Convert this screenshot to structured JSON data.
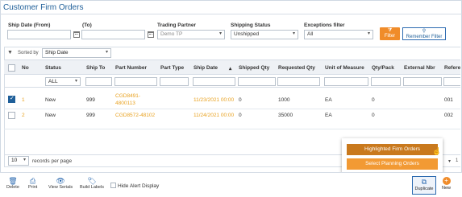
{
  "page": {
    "title": "Customer Firm Orders"
  },
  "filters": {
    "ship_date_from_label": "Ship Date (From)",
    "ship_date_to_label": "(To)",
    "ship_date_from_value": "",
    "ship_date_to_value": "",
    "trading_partner_label": "Trading Partner",
    "trading_partner_value": "Demo TP",
    "shipping_status_label": "Shipping Status",
    "shipping_status_value": "Unshipped",
    "exceptions_label": "Exceptions filter",
    "exceptions_value": "All",
    "filter_button": "Filter",
    "remember_button": "Remember Filter"
  },
  "sort": {
    "label": "Sorted by",
    "value": "Ship Date"
  },
  "table": {
    "headers": [
      "No",
      "Status",
      "Ship To",
      "Part Number",
      "Part Type",
      "Ship Date",
      "Shipped Qty",
      "Requested Qty",
      "Unit of Measure",
      "Qty/Pack",
      "External Nbr",
      "Refere"
    ],
    "status_filter": "ALL",
    "rows": [
      {
        "checked": true,
        "no": "1",
        "status": "New",
        "ship_to": "999",
        "part_number": "CGD8491-4800113",
        "part_type": "",
        "ship_date": "11/23/2021 00:00",
        "shipped_qty": "0",
        "requested_qty": "1000",
        "uom": "EA",
        "qty_pack": "0",
        "external_nbr": "",
        "reference": "001"
      },
      {
        "checked": false,
        "no": "2",
        "status": "New",
        "ship_to": "999",
        "part_number": "CGD8572-48102",
        "part_type": "",
        "ship_date": "11/24/2021 00:00",
        "shipped_qty": "0",
        "requested_qty": "35000",
        "uom": "EA",
        "qty_pack": "0",
        "external_nbr": "",
        "reference": "002"
      }
    ]
  },
  "pager": {
    "per_page": "10",
    "per_page_label": "records per page",
    "page_value": "1"
  },
  "popup": {
    "highlighted": "Highlighted Firm Orders",
    "planning": "Select Planning Orders"
  },
  "toolbar": {
    "delete": "Delete",
    "print": "Print",
    "view_serials": "View Serials",
    "build_labels": "Build Labels",
    "hide_alert": "Hide Alert Display",
    "duplicate": "Duplicate",
    "new": "New"
  },
  "colors": {
    "accent": "#f08c2a",
    "brand": "#1f5f99",
    "link": "#e8a11f"
  }
}
